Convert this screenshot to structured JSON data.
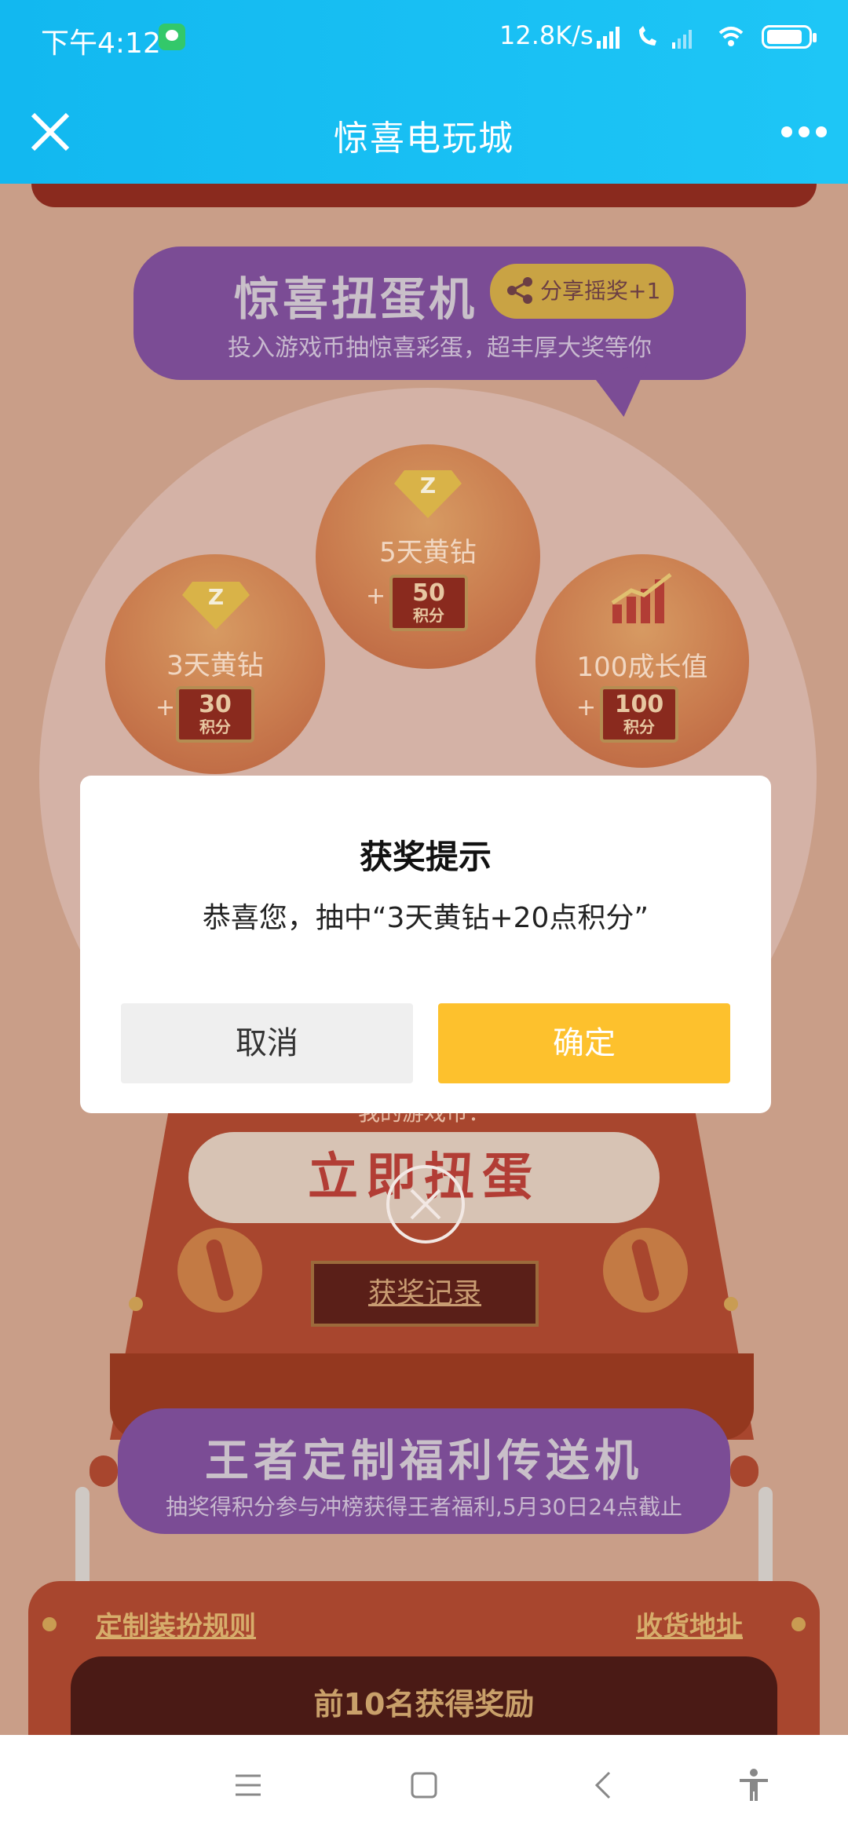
{
  "status_bar": {
    "time": "下午4:12",
    "network_speed": "12.8K/s",
    "icons": [
      "chat-app-icon",
      "signal-hd-icon",
      "call-icon",
      "signal-weak-icon",
      "wifi-icon",
      "battery-icon"
    ]
  },
  "title_bar": {
    "title": "惊喜电玩城",
    "close_icon": "close-icon",
    "more_icon": "more-icon"
  },
  "page": {
    "banner": {
      "title": "惊喜扭蛋机",
      "share_label": "分享摇奖+1",
      "subtitle": "投入游戏币抽惊喜彩蛋，超丰厚大奖等你"
    },
    "prizes": [
      {
        "label": "3天黄钻",
        "points": "30",
        "unit": "积分",
        "icon": "diamond-icon"
      },
      {
        "label": "5天黄钻",
        "points": "50",
        "unit": "积分",
        "icon": "diamond-icon"
      },
      {
        "label": "100成长值",
        "points": "100",
        "unit": "积分",
        "icon": "growth-chart-icon"
      }
    ],
    "machine": {
      "hint": "我的游戏币：",
      "spin_label": "立即扭蛋",
      "record_label": "获奖记录"
    },
    "banner2": {
      "title": "王者定制福利传送机",
      "subtitle": "抽奖得积分参与冲榜获得王者福利,5月30日24点截止"
    },
    "board": {
      "rules_link": "定制装扮规则",
      "address_link": "收货地址",
      "reward_title": "前10名获得奖励"
    }
  },
  "modal": {
    "title": "获奖提示",
    "message": "恭喜您，抽中“3天黄钻+20点积分”",
    "cancel_label": "取消",
    "confirm_label": "确定"
  },
  "nav_bar": {
    "icons": [
      "menu-icon",
      "home-icon",
      "back-icon",
      "accessibility-icon"
    ]
  },
  "colors": {
    "title_bar": "#1ec6f6",
    "confirm_button": "#fdc12d",
    "cancel_button": "#efefef",
    "banner": "#7b4c95"
  }
}
